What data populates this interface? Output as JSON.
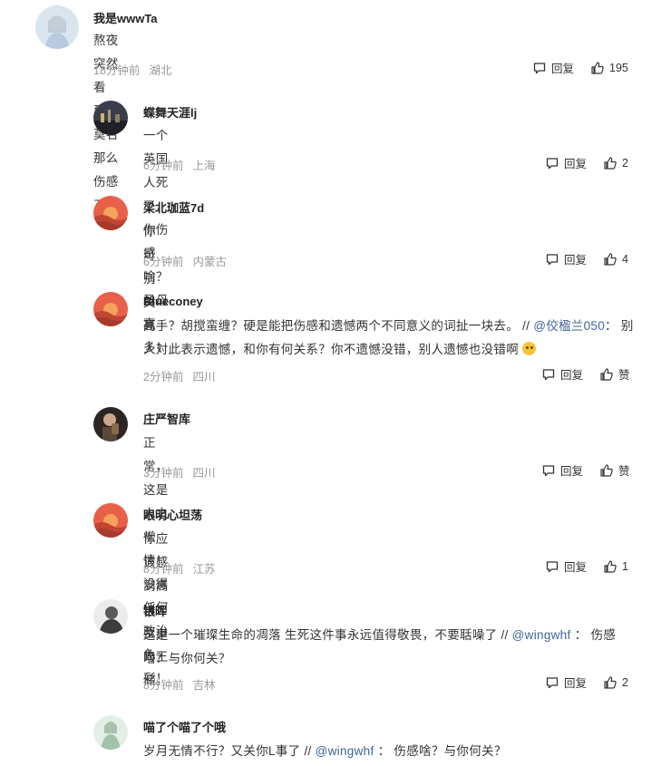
{
  "labels": {
    "reply": "回复"
  },
  "comments": [
    {
      "user": "我是wwwTa",
      "text": "熬夜突然看到，莫名那么伤感了",
      "time": "18分钟前",
      "location": "湖北",
      "likes": "195"
    },
    {
      "user": "蝶舞天涯lj",
      "text": "一个英国人死了，你伤感啥？圣母真多！",
      "time": "6分钟前",
      "location": "上海",
      "likes": "2"
    },
    {
      "user": "梁北珈蓝7d",
      "text": "你可别哭死",
      "time": "6分钟前",
      "location": "内蒙古",
      "likes": "4"
    },
    {
      "user": "Blueconey",
      "text_a": "高手？胡搅蛮缠？硬是能把伤感和遗憾两个不同意义的词扯一块去。 // ",
      "mention": "@佼楹兰050",
      "text_b": "： 别人对此表示遗憾，和你有何关系？你不遗憾没错，别人遗憾也没错啊",
      "time": "2分钟前",
      "location": "四川",
      "likes": "赞"
    },
    {
      "user": "庄严智库",
      "text": "正常，这是人之常情！没得任何政治色彩！",
      "time": "3分钟前",
      "location": "四川",
      "likes": "赞"
    },
    {
      "user": "眼明心坦荡",
      "text": "你应该感到高兴，至少为王储。",
      "time": "8分钟前",
      "location": "江苏",
      "likes": "1"
    },
    {
      "user": "银晖",
      "text_a": "这是一个璀璨生命的凋落 生死这件事永远值得敬畏，不要聒噪了 // ",
      "mention": "@wingwhf",
      "text_b": " ： 伤感啥？与你何关？",
      "time": "8分钟前",
      "location": "吉林",
      "likes": "2"
    },
    {
      "user": "喵了个喵了个哦",
      "text_a": "岁月无情不行？又关你L事了 // ",
      "mention": "@wingwhf",
      "text_b": " ： 伤感啥？与你何关？"
    }
  ]
}
